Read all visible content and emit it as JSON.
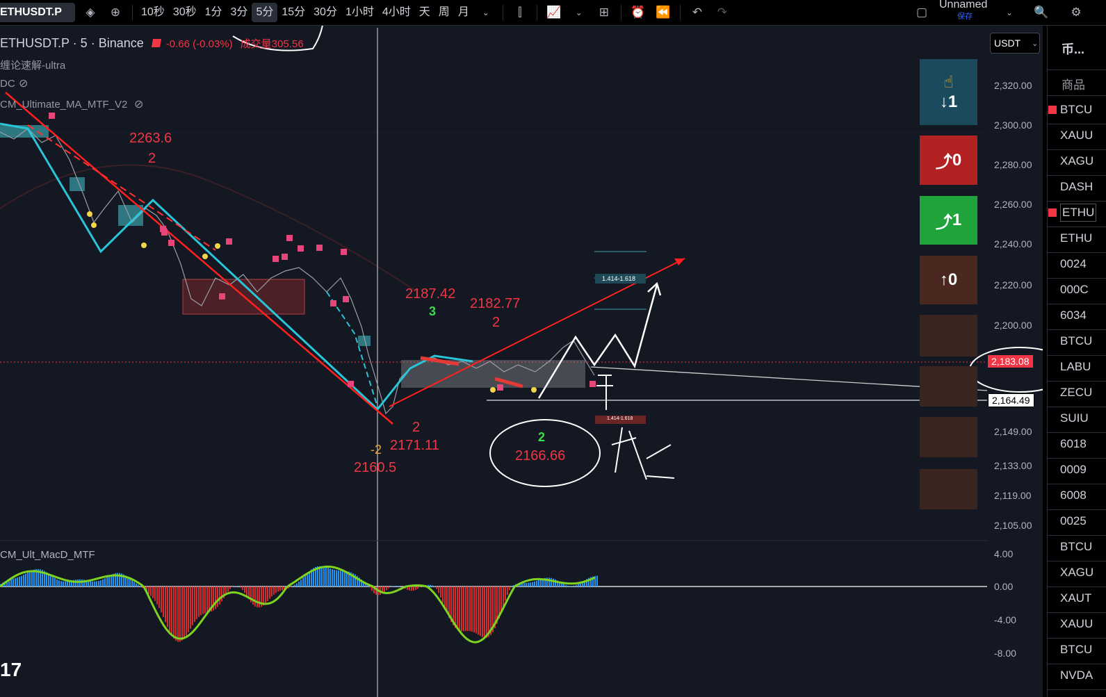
{
  "toolbar": {
    "symbol": "ETHUSDT.P",
    "timeframes": [
      "10秒",
      "30秒",
      "1分",
      "3分",
      "5分",
      "15分",
      "30分",
      "1小时",
      "4小时",
      "天",
      "周",
      "月"
    ],
    "active_timeframe": "5分",
    "layout_name": "Unnamed",
    "layout_status": "保存"
  },
  "legend": {
    "title": "ETHUSDT.P · 5 · Binance",
    "change": "-0.66 (-0.03%)",
    "volume_label": "成交量",
    "volume_value": "305.56",
    "indicator1": "缠论速解-ultra",
    "indicator2": "DC",
    "indicator3": "CM_Ultimate_MA_MTF_V2",
    "macd_label": "CM_Ult_MacD_MTF"
  },
  "currency": "USDT",
  "price_axis": [
    "2,320.00",
    "2,300.00",
    "2,280.00",
    "2,260.00",
    "2,240.00",
    "2,220.00",
    "2,200.00",
    "2,183.08",
    "2,164.49",
    "2,149.00",
    "2,133.00",
    "2,119.00",
    "2,105.00"
  ],
  "macd_axis": [
    "4.00",
    "0.00",
    "-4.00",
    "-8.00"
  ],
  "current_price": "2,183.08",
  "marked_price": "2,164.49",
  "annotations": {
    "a1": "2263.6",
    "a1_wave": "2",
    "a2": "2187.42",
    "a2_wave": "3",
    "a3": "2182.77",
    "a3_wave": "2",
    "a4": "2171.11",
    "a4_wave": "2",
    "a5": "2160.5",
    "a5_wave": "-2",
    "a6": "2166.66",
    "a6_wave": "2",
    "fib1": "1.414-1.618",
    "fib2": "1.414-1.618",
    "handwriting": "干 战"
  },
  "signals": [
    {
      "label": "1",
      "bg": "#1b4a5c",
      "icon": "↓"
    },
    {
      "label": "0",
      "bg": "#b22222",
      "icon": "⤴"
    },
    {
      "label": "1",
      "bg": "#1fa33b",
      "icon": "⤴"
    },
    {
      "label": "0",
      "bg": "#4a2820",
      "icon": "↑"
    }
  ],
  "watchlist": {
    "header": "币...",
    "section": "商品",
    "items": [
      "BTCU",
      "XAUU",
      "XAGU",
      "DASH",
      "ETHU",
      "ETHU",
      "0024",
      "000C",
      "6034",
      "BTCU",
      "LABU",
      "ZECU",
      "SUIU",
      "6018",
      "0009",
      "6008",
      "0025",
      "BTCU",
      "XAGU",
      "XAUT",
      "XAUU",
      "BTCU",
      "NVDA"
    ]
  },
  "colors": {
    "bg": "#141823",
    "up": "#26a69a",
    "down": "#f23645",
    "cyan": "#29c5d8",
    "accent_red": "#ff2020"
  }
}
